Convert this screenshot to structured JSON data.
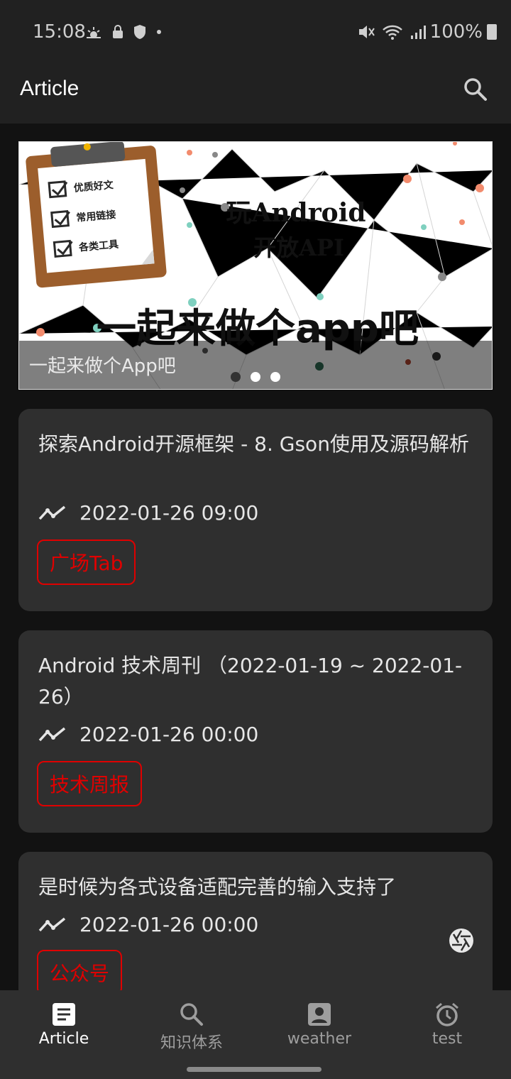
{
  "status_bar": {
    "time": "15:08",
    "battery": "100%"
  },
  "app_bar": {
    "title": "Article",
    "search_icon": "search-icon"
  },
  "banner": {
    "image_text_main": "玩Android",
    "image_text_sub": "开放API",
    "image_text_big": "一起来做个app吧",
    "clip_items": [
      "优质好文",
      "常用链接",
      "各类工具"
    ],
    "caption": "一起来做个App吧",
    "dots_count": 3,
    "active_dot": 0
  },
  "articles": [
    {
      "title": "探索Android开源框架 - 8. Gson使用及源码解析",
      "date": "2022-01-26 09:00",
      "tag": "广场Tab"
    },
    {
      "title": "Android 技术周刊 （2022-01-19 ~ 2022-01-26）",
      "date": "2022-01-26 00:00",
      "tag": "技术周报"
    },
    {
      "title": "是时候为各式设备适配完善的输入支持了",
      "date": "2022-01-26 00:00",
      "tag": "公众号"
    }
  ],
  "bottom_nav": [
    {
      "label": "Article",
      "icon": "article-icon",
      "active": true
    },
    {
      "label": "知识体系",
      "icon": "search-icon",
      "active": false
    },
    {
      "label": "weather",
      "icon": "account-box-icon",
      "active": false
    },
    {
      "label": "test",
      "icon": "alarm-icon",
      "active": false
    }
  ],
  "colors": {
    "background": "#121212",
    "surface": "#2f2f2f",
    "tag_red": "#e00000"
  }
}
